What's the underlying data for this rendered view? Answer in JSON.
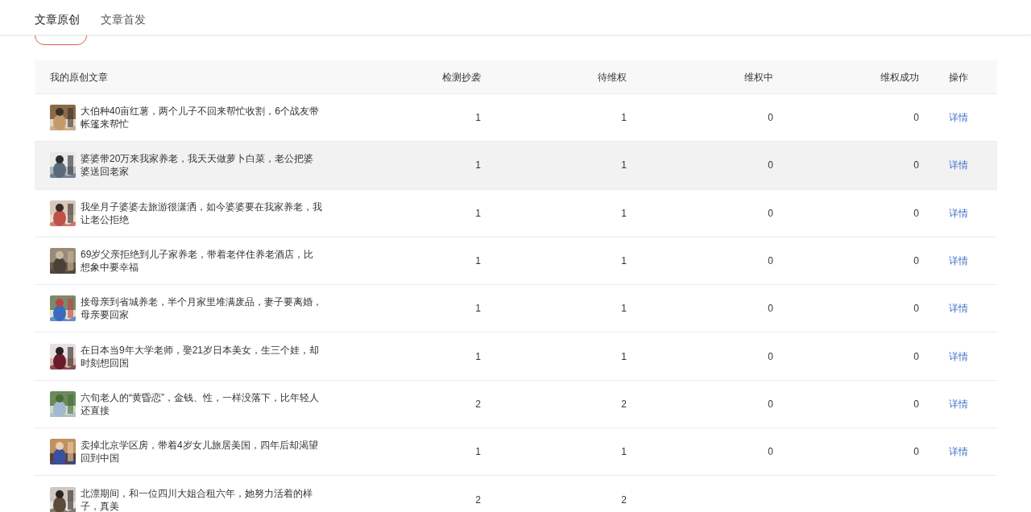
{
  "tabs": [
    {
      "label": "文章原创",
      "selected": true
    },
    {
      "label": "文章首发",
      "selected": false
    }
  ],
  "table": {
    "columns": [
      "我的原创文章",
      "检测抄袭",
      "待维权",
      "维权中",
      "维权成功",
      "操作"
    ],
    "rows": [
      {
        "title": "大伯种40亩红薯，两个儿子不回来帮忙收割，6个战友带帐篷来帮忙",
        "values": [
          "1",
          "1",
          "0",
          "0"
        ],
        "action": "详情",
        "hovered": false
      },
      {
        "title": "婆婆带20万来我家养老，我天天做萝卜白菜，老公把婆婆送回老家",
        "values": [
          "1",
          "1",
          "0",
          "0"
        ],
        "action": "详情",
        "hovered": true
      },
      {
        "title": "我坐月子婆婆去旅游很潇洒，如今婆婆要在我家养老，我让老公拒绝",
        "values": [
          "1",
          "1",
          "0",
          "0"
        ],
        "action": "详情",
        "hovered": false
      },
      {
        "title": "69岁父亲拒绝到儿子家养老，带着老伴住养老酒店，比想象中要幸福",
        "values": [
          "1",
          "1",
          "0",
          "0"
        ],
        "action": "详情",
        "hovered": false
      },
      {
        "title": "接母亲到省城养老，半个月家里堆满废品，妻子要离婚，母亲要回家",
        "values": [
          "1",
          "1",
          "0",
          "0"
        ],
        "action": "详情",
        "hovered": false
      },
      {
        "title": "在日本当9年大学老师，娶21岁日本美女，生三个娃，却时刻想回国",
        "values": [
          "1",
          "1",
          "0",
          "0"
        ],
        "action": "详情",
        "hovered": false
      },
      {
        "title": "六旬老人的“黄昏恋”，金钱、性，一样没落下，比年轻人还直接",
        "values": [
          "2",
          "2",
          "0",
          "0"
        ],
        "action": "详情",
        "hovered": false
      },
      {
        "title": "卖掉北京学区房，带着4岁女儿旅居美国，四年后却渴望回到中国",
        "values": [
          "1",
          "1",
          "0",
          "0"
        ],
        "action": "详情",
        "hovered": false
      },
      {
        "title": "北漂期间，和一位四川大姐合租六年，她努力活着的样子，真美",
        "values": [
          "2",
          "2"
        ],
        "hovered": false
      }
    ]
  }
}
